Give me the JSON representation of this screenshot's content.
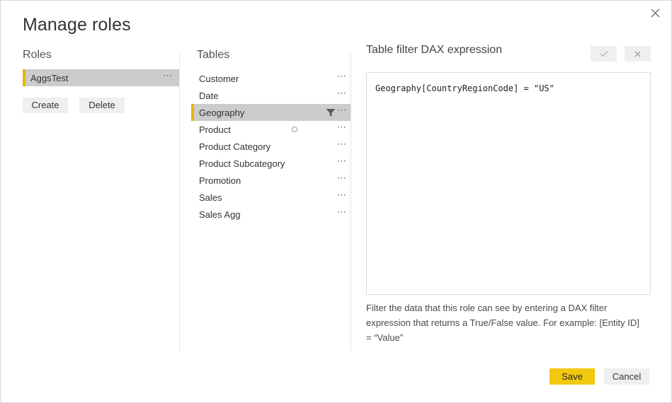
{
  "dialog": {
    "title": "Manage roles",
    "close_icon": "close-icon"
  },
  "roles": {
    "header": "Roles",
    "items": [
      {
        "label": "AggsTest",
        "selected": true,
        "menu": "⋯"
      }
    ],
    "create_label": "Create",
    "delete_label": "Delete"
  },
  "tables": {
    "header": "Tables",
    "menu_glyph": "⋯",
    "items": [
      {
        "label": "Customer",
        "selected": false,
        "has_filter": false,
        "has_dot": false
      },
      {
        "label": "Date",
        "selected": false,
        "has_filter": false,
        "has_dot": false
      },
      {
        "label": "Geography",
        "selected": true,
        "has_filter": true,
        "has_dot": false
      },
      {
        "label": "Product",
        "selected": false,
        "has_filter": false,
        "has_dot": true
      },
      {
        "label": "Product Category",
        "selected": false,
        "has_filter": false,
        "has_dot": false
      },
      {
        "label": "Product Subcategory",
        "selected": false,
        "has_filter": false,
        "has_dot": false
      },
      {
        "label": "Promotion",
        "selected": false,
        "has_filter": false,
        "has_dot": false
      },
      {
        "label": "Sales",
        "selected": false,
        "has_filter": false,
        "has_dot": false
      },
      {
        "label": "Sales Agg",
        "selected": false,
        "has_filter": false,
        "has_dot": false
      }
    ]
  },
  "dax": {
    "header": "Table filter DAX expression",
    "accept_icon": "checkmark-icon",
    "reject_icon": "close-icon",
    "expression": "Geography[CountryRegionCode] = \"US\"",
    "placeholder": "",
    "help_text": "Filter the data that this role can see by entering a DAX filter expression that returns a True/False value. For example: [Entity ID] = “Value”"
  },
  "footer": {
    "save_label": "Save",
    "cancel_label": "Cancel"
  },
  "colors": {
    "accent_yellow": "#e8b40a",
    "save_yellow": "#f2c811",
    "selected_gray": "#cccccc",
    "button_gray": "#efefef"
  }
}
